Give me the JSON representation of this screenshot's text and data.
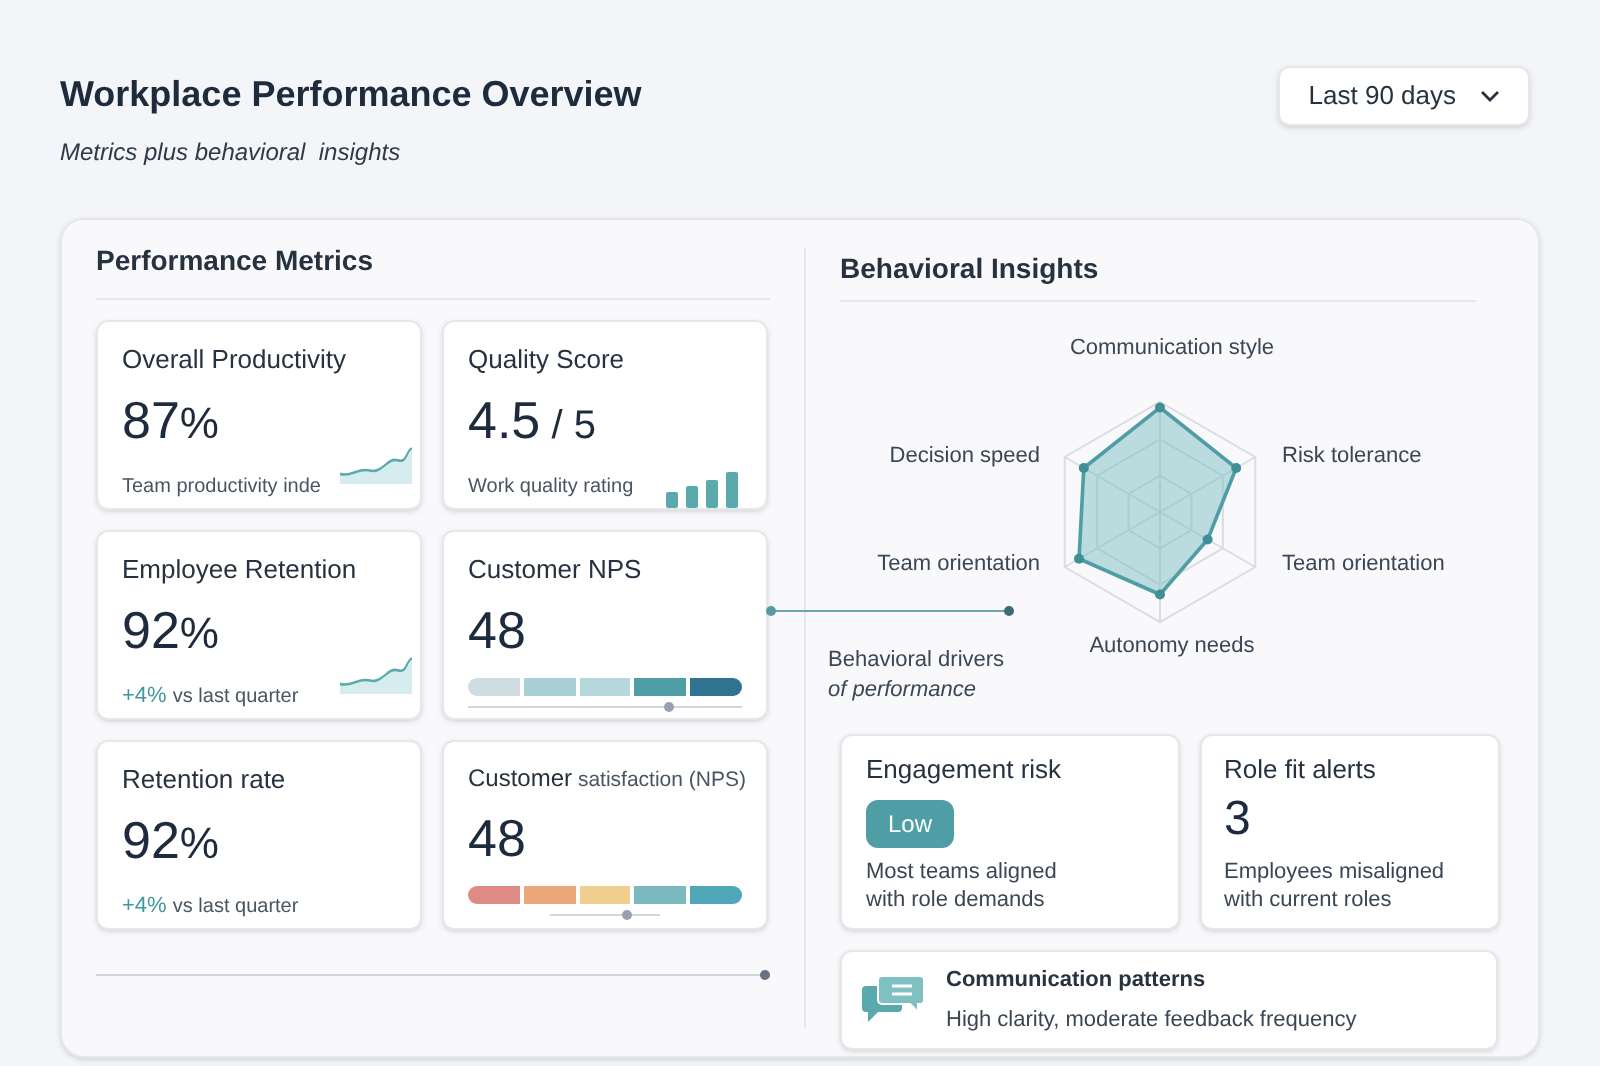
{
  "header": {
    "title": "Workplace Performance Overview",
    "subtitle": "Metrics plus behavioral  insights",
    "range": "Last 90 days"
  },
  "metrics": {
    "heading": "Performance Metrics",
    "cards": [
      {
        "kind": "sparkline",
        "title": "Overall Productivity",
        "value": "87",
        "unit": "%",
        "caption": "Team productivity inde"
      },
      {
        "kind": "bars",
        "title": "Quality Score",
        "value": "4.5",
        "unit": "/ 5",
        "caption": "Work quality rating"
      },
      {
        "kind": "sparkline",
        "title": "Employee Retention",
        "value": "92",
        "unit": "%",
        "delta": "+4%",
        "caption": "vs last quarter"
      },
      {
        "kind": "segments",
        "title": "Customer NPS",
        "value": "48"
      },
      {
        "kind": "plain",
        "title": "Retention rate",
        "value": "92",
        "unit": "%",
        "delta": "+4%",
        "caption": "vs last quarter"
      },
      {
        "kind": "colored",
        "title": "Customer",
        "title_rest": "satisfaction (NPS)",
        "value": "48"
      }
    ]
  },
  "insights": {
    "heading": "Behavioral Insights",
    "axes": [
      "Communication style",
      "Risk tolerance",
      "Team orientation",
      "Autonomy needs",
      "Team orientation",
      "Decision speed"
    ],
    "drivers": "Behavioral drivers",
    "drivers_italic": "of performance",
    "engagement": {
      "title": "Engagement risk",
      "badge": "Low",
      "text": "Most teams aligned with role demands"
    },
    "rolefit": {
      "title": "Role fit alerts",
      "value": "3",
      "text": "Employees misaligned with current roles"
    },
    "communication": {
      "title": "Communication patterns",
      "text": "High clarity, moderate feedback frequency"
    }
  }
}
